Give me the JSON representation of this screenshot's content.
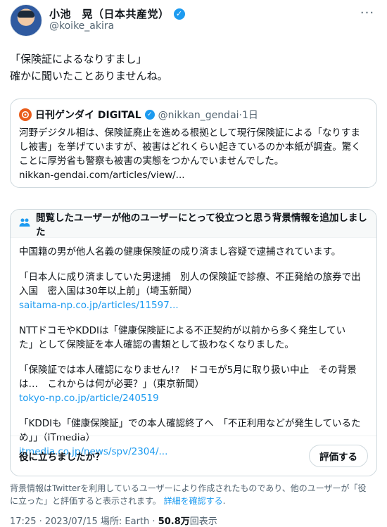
{
  "author": {
    "display_name": "小池　晃（日本共産党）",
    "verified_mark": "✓",
    "handle": "@koike_akira",
    "more": "···"
  },
  "tweet": {
    "lines": [
      "「保険証によるなりすまし」",
      "確かに聞いたことありませんね。"
    ]
  },
  "quote": {
    "name": "日刊ゲンダイ DIGITAL",
    "verified_mark": "✓",
    "handle_time": "@nikkan_gendai·1日",
    "lines": [
      "河野デジタル相は、保険証廃止を進める根拠として現行保険証による「なりすま",
      "し被害」を挙げていますが、被害はどれくらい起きているのか本紙が調査。驚く",
      "ことに厚労省も警察も被害の実態をつかんでいませんでした。"
    ],
    "link": "nikkan-gendai.com/articles/view/..."
  },
  "note": {
    "header": "閲覧したユーザーが他のユーザーにとって役立つと思う背景情報を追加しました",
    "p1": "中国籍の男が他人名義の健康保険証の成り済まし容疑で逮捕されています。",
    "p2_lines": [
      "「日本人に成り済ましていた男逮捕　別人の保険証で診療、不正発給の旅券で出",
      "入国　密入国は30年以上前」（埼玉新聞）"
    ],
    "p2_link": "saitama-np.co.jp/articles/11597...",
    "p3_lines": [
      "NTTドコモやKDDIは「健康保険証による不正契約が以前から多く発生してい",
      "た」として保険証を本人確認の書類として扱わなくなりました。"
    ],
    "p4_lines": [
      "「保険証では本人確認になりません!?　ドコモが5月に取り扱い中止　その背景",
      "は…　これからは何が必要？」（東京新聞）"
    ],
    "p4_link": "tokyo-np.co.jp/article/240519",
    "p5_lines": [
      "「KDDIも「健康保険証」での本人確認終了へ　「不正利用などが発生しているた",
      "め」」（ITmedia）"
    ],
    "p5_link": "itmedia.co.jp/news/spv/2304/...",
    "helpful_question": "役に立ちましたか？",
    "rate_button": "評価する"
  },
  "disclaimer": {
    "text_line1": "背景情報はTwitterを利用しているユーザーにより作成されたものであり、他のユーザーが「役",
    "text_line2": "に立った」と評価すると表示されます。",
    "learn_more": "詳細を確認する",
    "period": "."
  },
  "meta": {
    "time_date_place": "17:25 · 2023/07/15 場所: Earth · ",
    "views_count": "50.8万",
    "views_label": "回表示"
  }
}
